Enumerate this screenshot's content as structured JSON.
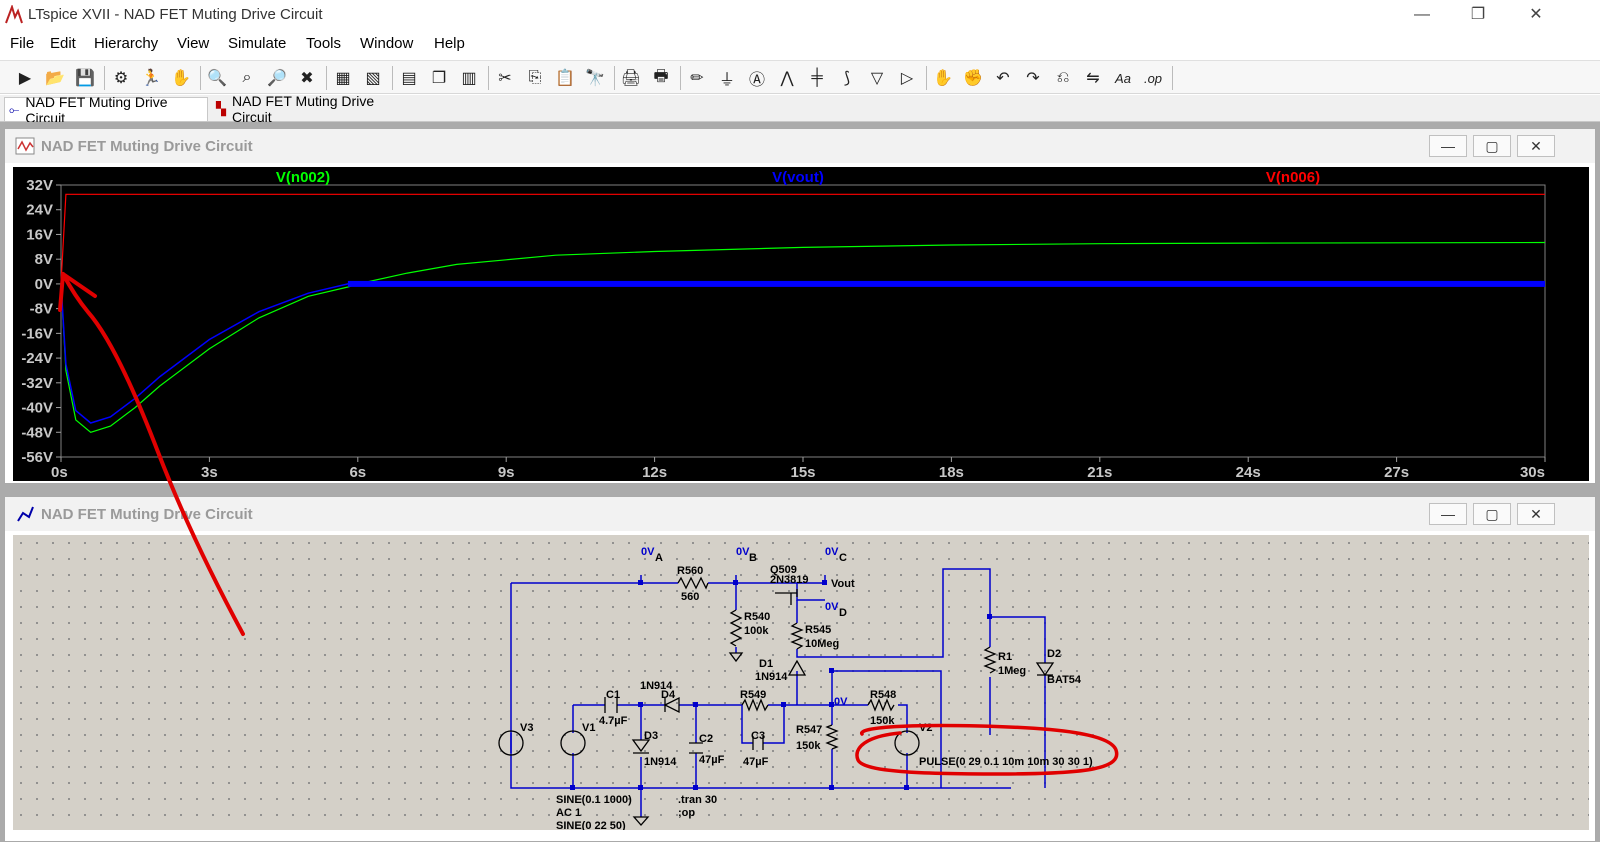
{
  "window": {
    "title": "LTspice XVII - NAD FET Muting Drive Circuit",
    "minimize": "—",
    "maximize": "❐",
    "close": "✕"
  },
  "menu": [
    "File",
    "Edit",
    "Hierarchy",
    "View",
    "Simulate",
    "Tools",
    "Window",
    "Help"
  ],
  "toolbar": {
    "icons": [
      "run-icon",
      "open-icon",
      "save-icon",
      "control-panel-icon",
      "run-simulation-icon",
      "halt-icon",
      "zoom-in-icon",
      "zoom-full-icon",
      "zoom-out-icon",
      "zoom-cancel-icon",
      "autorange-icon",
      "mark-unref-icon",
      "tile-horizontal-icon",
      "cascade-icon",
      "tile-vertical-icon",
      "cut-icon",
      "copy-icon",
      "paste-icon",
      "find-icon",
      "print-icon",
      "print-setup-icon",
      "draw-wire-icon",
      "ground-icon",
      "label-net-icon",
      "resistor-icon",
      "capacitor-icon",
      "inductor-icon",
      "diode-icon",
      "component-icon",
      "move-icon",
      "drag-icon",
      "undo-icon",
      "redo-icon",
      "rotate-icon",
      "mirror-icon",
      "text-icon",
      "spice-directive-icon"
    ],
    "glyphs": [
      "▶",
      "📂",
      "💾",
      "⚙",
      "🏃",
      "✋",
      "🔍",
      "⌕",
      "🔎",
      "✖",
      "▦",
      "▧",
      "▤",
      "❐",
      "▥",
      "✂",
      "⎘",
      "📋",
      "🔭",
      "🖨",
      "🖶",
      "✏",
      "⏚",
      "Ⓐ",
      "⋀",
      "╪",
      "⟆",
      "▽",
      "▷",
      "✋",
      "✊",
      "↶",
      "↷",
      "⎌",
      "⇋",
      "Aa",
      ".op"
    ]
  },
  "tabs": [
    {
      "label": "NAD FET Muting Drive Circuit",
      "active": true,
      "icon": "schematic-icon"
    },
    {
      "label": "NAD FET Muting Drive Circuit",
      "active": false,
      "icon": "waveform-icon"
    }
  ],
  "plot_window": {
    "title": "NAD FET Muting Drive Circuit",
    "min": "—",
    "max": "▢",
    "close": "✕"
  },
  "schematic_window": {
    "title": "NAD FET Muting Drive Circuit",
    "min": "—",
    "max": "▢",
    "close": "✕"
  },
  "chart_data": {
    "type": "line",
    "x": [
      0,
      0.1,
      0.3,
      0.6,
      1,
      1.5,
      2,
      3,
      4,
      5,
      5.8,
      6,
      7,
      8,
      9,
      10,
      12,
      15,
      18,
      21,
      24,
      27,
      30
    ],
    "xlim": [
      0,
      30
    ],
    "ylim": [
      -56,
      32
    ],
    "x_ticks": [
      "0s",
      "3s",
      "6s",
      "9s",
      "12s",
      "15s",
      "18s",
      "21s",
      "24s",
      "27s",
      "30s"
    ],
    "y_ticks": [
      "32V",
      "24V",
      "16V",
      "8V",
      "0V",
      "-8V",
      "-16V",
      "-24V",
      "-32V",
      "-40V",
      "-48V",
      "-56V"
    ],
    "grid": false,
    "background": "#000000",
    "series": [
      {
        "name": "V(n002)",
        "color": "#00ff00",
        "values": [
          0,
          -28,
          -44,
          -48,
          -46,
          -40,
          -33,
          -21,
          -11,
          -4,
          -1,
          0,
          3.5,
          6.3,
          7.8,
          9.3,
          10.5,
          11.8,
          12.6,
          13,
          13.2,
          13.3,
          13.4
        ]
      },
      {
        "name": "V(vout)",
        "color": "#0000ff",
        "values": [
          0,
          -26,
          -41,
          -45,
          -43,
          -37,
          -30,
          -18,
          -9,
          -3,
          0,
          0,
          0,
          0,
          0,
          0,
          0,
          0,
          0,
          0,
          0,
          0,
          0
        ]
      },
      {
        "name": "V(n006)",
        "color": "#ff0000",
        "values": [
          0,
          29,
          29,
          29,
          29,
          29,
          29,
          29,
          29,
          29,
          29,
          29,
          29,
          29,
          29,
          29,
          29,
          29,
          29,
          29,
          29,
          29,
          29
        ]
      }
    ]
  },
  "schematic": {
    "nodes": [
      "0V",
      "A",
      "0V",
      "B",
      "0V",
      "C",
      "0V",
      "D",
      "0V"
    ],
    "net_labels": [
      "Vout"
    ],
    "components": [
      {
        "ref": "R560",
        "value": "560"
      },
      {
        "ref": "Q509",
        "value": "2N3819"
      },
      {
        "ref": "R540",
        "value": "100k"
      },
      {
        "ref": "R545",
        "value": "10Meg"
      },
      {
        "ref": "D1",
        "value": "1N914"
      },
      {
        "ref": "R1",
        "value": "1Meg"
      },
      {
        "ref": "D2",
        "value": "BAT54"
      },
      {
        "ref": "C1",
        "value": "4.7µF"
      },
      {
        "ref": "D4",
        "value": "1N914"
      },
      {
        "ref": "R549",
        "value": ""
      },
      {
        "ref": "R548",
        "value": "150k"
      },
      {
        "ref": "V3",
        "value": ""
      },
      {
        "ref": "V1",
        "value": ""
      },
      {
        "ref": "D3",
        "value": "1N914"
      },
      {
        "ref": "C2",
        "value": "47µF"
      },
      {
        "ref": "C3",
        "value": "47µF"
      },
      {
        "ref": "R547",
        "value": "150k"
      },
      {
        "ref": "V2",
        "value": ""
      }
    ],
    "texts": {
      "v2_pulse": "PULSE(0 29 0.1 10m 10m 30 30 1)",
      "v1_sine": "SINE(0.1 1000)",
      "v1_ac": "AC 1",
      "v3_sine": "SINE(0 22 50)",
      "tran": ".tran 30",
      "op": ";op"
    }
  },
  "colors": {
    "wire": "#0000cc",
    "component": "#000000",
    "annotation": "#e00000",
    "canvas": "#d4d0c8"
  }
}
